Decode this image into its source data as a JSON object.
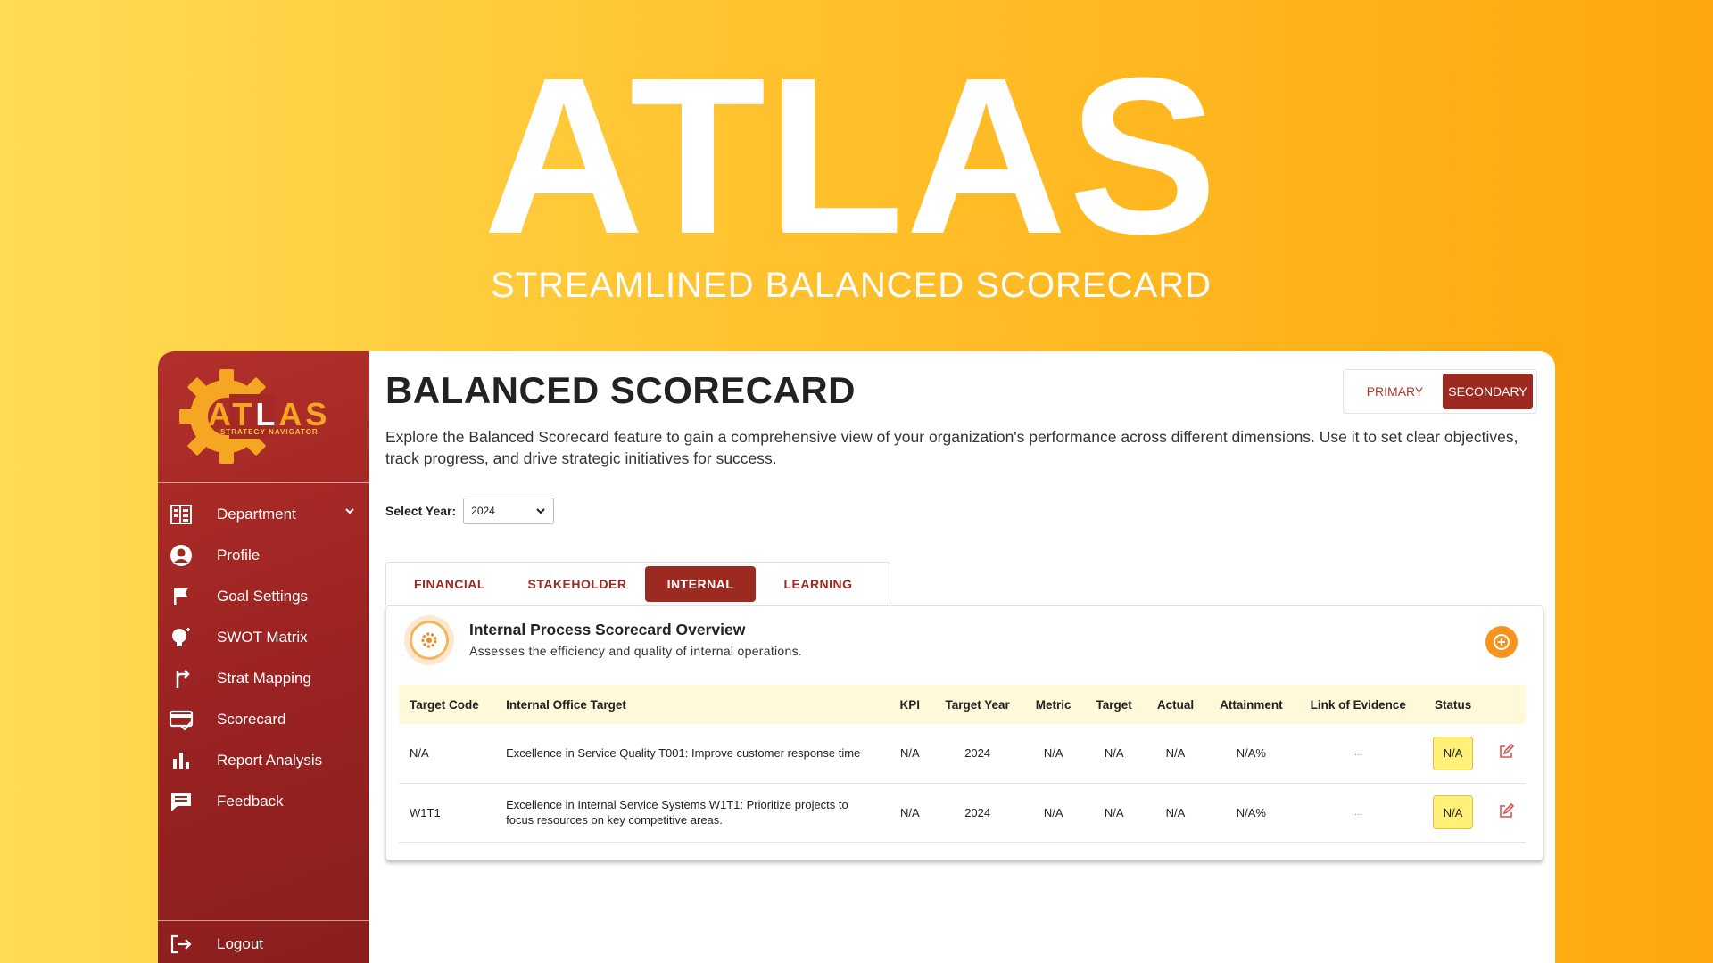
{
  "hero": {
    "title": "ATLAS",
    "subtitle": "STREAMLINED BALANCED SCORECARD"
  },
  "logo": {
    "text_orange_1": "AT",
    "text_white": "L",
    "text_orange_2": "AS",
    "tagline": "STRATEGY NAVIGATOR"
  },
  "sidebar": {
    "items": [
      {
        "label": "Department",
        "icon": "building-icon"
      },
      {
        "label": "Profile",
        "icon": "user-circle-icon"
      },
      {
        "label": "Goal Settings",
        "icon": "flag-icon"
      },
      {
        "label": "SWOT Matrix",
        "icon": "lightbulb-icon"
      },
      {
        "label": "Strat Mapping",
        "icon": "route-icon"
      },
      {
        "label": "Scorecard",
        "icon": "card-check-icon"
      },
      {
        "label": "Report Analysis",
        "icon": "bar-chart-icon"
      },
      {
        "label": "Feedback",
        "icon": "message-icon"
      }
    ],
    "logout_label": "Logout"
  },
  "header": {
    "title": "BALANCED SCORECARD",
    "primary_label": "PRIMARY",
    "secondary_label": "SECONDARY",
    "selected_view": "SECONDARY"
  },
  "description": "Explore the Balanced Scorecard feature to gain a comprehensive view of your organization's performance across different dimensions. Use it to set clear objectives, track progress, and drive strategic initiatives for success.",
  "year_filter": {
    "label": "Select Year:",
    "value": "2024"
  },
  "tabs": [
    {
      "label": "FINANCIAL"
    },
    {
      "label": "STAKEHOLDER"
    },
    {
      "label": "INTERNAL"
    },
    {
      "label": "LEARNING"
    }
  ],
  "active_tab": "INTERNAL",
  "card": {
    "title": "Internal Process Scorecard Overview",
    "subtitle": "Assesses the efficiency and quality of internal operations."
  },
  "table": {
    "headers": [
      "Target Code",
      "Internal Office Target",
      "KPI",
      "Target Year",
      "Metric",
      "Target",
      "Actual",
      "Attainment",
      "Link of Evidence",
      "Status"
    ],
    "rows": [
      {
        "code": "N/A",
        "target": "Excellence in Service Quality T001: Improve customer response time",
        "kpi": "N/A",
        "year": "2024",
        "metric": "N/A",
        "target_val": "N/A",
        "actual": "N/A",
        "attainment": "N/A%",
        "link": "...",
        "status": "N/A"
      },
      {
        "code": "W1T1",
        "target": "Excellence in Internal Service Systems W1T1: Prioritize projects to focus resources on key competitive areas.",
        "kpi": "N/A",
        "year": "2024",
        "metric": "N/A",
        "target_val": "N/A",
        "actual": "N/A",
        "attainment": "N/A%",
        "link": "...",
        "status": "N/A"
      }
    ]
  },
  "colors": {
    "brand_red": "#9c2a20",
    "accent_orange": "#f7941d",
    "status_yellow": "#fff07a",
    "header_row": "#fff8d9"
  }
}
